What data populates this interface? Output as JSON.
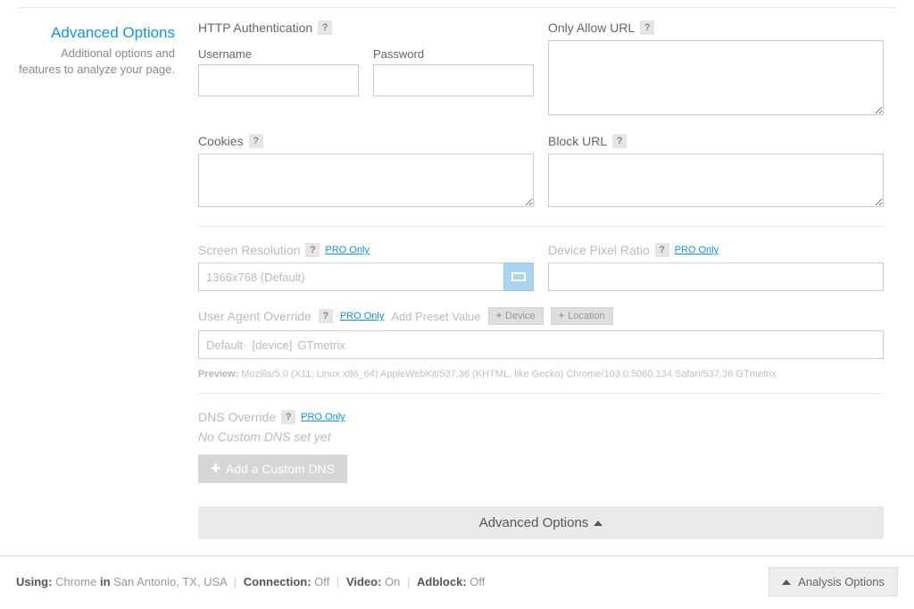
{
  "leftPanel": {
    "title": "Advanced Options",
    "subtitle": "Additional options and features to analyze your page."
  },
  "httpAuth": {
    "heading": "HTTP Authentication",
    "usernameLabel": "Username",
    "passwordLabel": "Password"
  },
  "onlyAllow": {
    "heading": "Only Allow URL"
  },
  "cookies": {
    "heading": "Cookies"
  },
  "blockUrl": {
    "heading": "Block URL"
  },
  "screenRes": {
    "heading": "Screen Resolution",
    "proLink": "PRO Only",
    "value": "1366x768 (Default)"
  },
  "devicePixel": {
    "heading": "Device Pixel Ratio",
    "proLink": "PRO Only"
  },
  "userAgent": {
    "heading": "User Agent Override",
    "proLink": "PRO Only",
    "presetLabel": "Add Preset Value",
    "deviceChip": "Device",
    "locationChip": "Location",
    "prefix": "Default·",
    "bracket": "[device]",
    "suffix": "GTmetrix",
    "previewLabel": "Preview:",
    "previewValue": "Mozilla/5.0 (X11; Linux x86_64) AppleWebKit/537.36 (KHTML, like Gecko) Chrome/103.0.5060.134 Safari/537.36 GTmetrix"
  },
  "dns": {
    "heading": "DNS Override",
    "proLink": "PRO Only",
    "emptyText": "No Custom DNS set yet",
    "addButton": "Add a Custom DNS"
  },
  "advBar": {
    "label": "Advanced Options"
  },
  "footer": {
    "usingLabel": "Using:",
    "browser": "Chrome",
    "inLabel": "in",
    "location": "San Antonio, TX, USA",
    "connectionLabel": "Connection:",
    "connectionValue": "Off",
    "videoLabel": "Video:",
    "videoValue": "On",
    "adblockLabel": "Adblock:",
    "adblockValue": "Off",
    "analysisButton": "Analysis Options"
  }
}
